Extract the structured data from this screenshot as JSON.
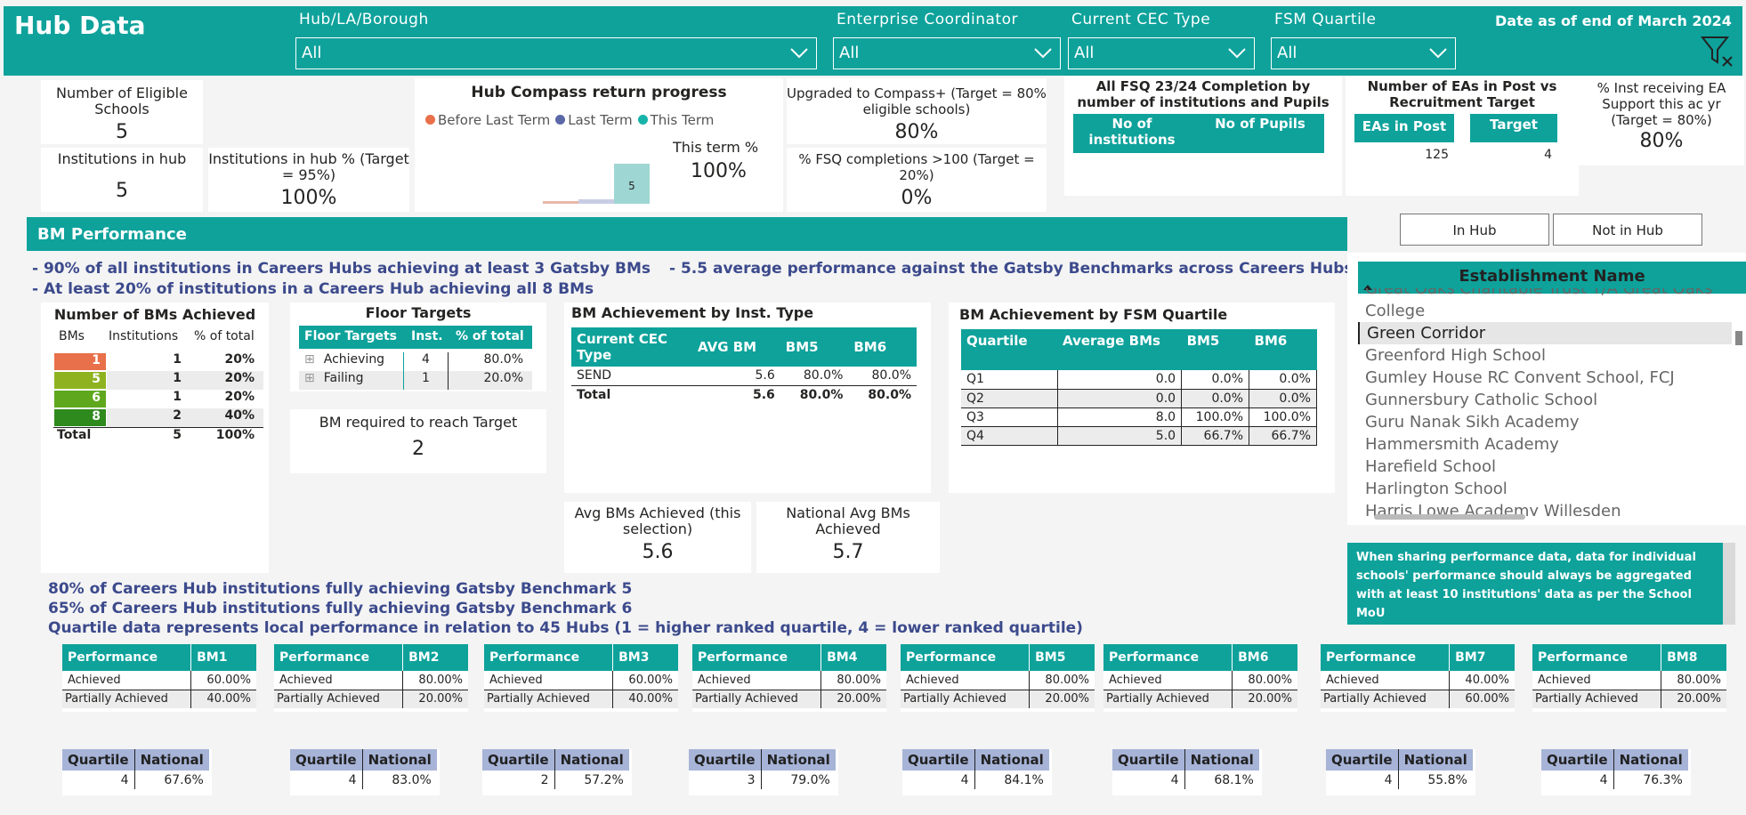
{
  "header": {
    "title": "Hub Data",
    "date_as_of": "Date as of end of March 2024",
    "filters": [
      {
        "label": "Hub/LA/Borough",
        "value": "All"
      },
      {
        "label": "Enterprise Coordinator",
        "value": "All"
      },
      {
        "label": "Current CEC Type",
        "value": "All"
      },
      {
        "label": "FSM Quartile",
        "value": "All"
      }
    ]
  },
  "kpis": {
    "eligible_label": "Number of Eligible Schools",
    "eligible_value": "5",
    "inst_label": "Institutions in hub",
    "inst_value": "5",
    "instpct_label": "Institutions in hub % (Target = 95%)",
    "instpct_value": "100%",
    "compass_title": "Hub Compass return progress",
    "compass_legend": [
      "Before Last Term",
      "Last Term",
      "This Term"
    ],
    "compass_legend_colors": [
      "#e8704a",
      "#5b68a8",
      "#16b3a9"
    ],
    "compass_thisterm_label": "This term %",
    "compass_thisterm_value": "100%",
    "compass_bar_label": "5",
    "upgraded_label": "Upgraded to Compass+ (Target = 80% eligible schools)",
    "upgraded_value": "80%",
    "fsq_label": "% FSQ completions >100 (Target = 20%)",
    "fsq_value": "0%",
    "fsq_title": "All FSQ 23/24 Completion by number of institutions and Pupils",
    "fsq_cols": [
      "No of institutions",
      "No of Pupils"
    ],
    "ea_title": "Number of EAs in Post vs Recruitment Target",
    "ea_cols": [
      "EAs in Post",
      "Target"
    ],
    "ea_values": [
      "125",
      "4"
    ],
    "inst_ea_label": "% Inst receiving EA Support this ac yr (Target = 80%)",
    "inst_ea_value": "80%"
  },
  "slicer": {
    "in_hub": "In Hub",
    "not_in_hub": "Not in Hub",
    "header": "Establishment Name",
    "items": [
      "Great Oaks Charitable Trust T/A Great Oaks",
      "College",
      "Green Corridor",
      "Greenford High School",
      "Gumley House RC Convent School, FCJ",
      "Gunnersbury Catholic School",
      "Guru Nanak Sikh Academy",
      "Hammersmith Academy",
      "Harefield School",
      "Harlington School",
      "Harris Lowe Academy Willesden"
    ],
    "selected": "Green Corridor"
  },
  "bm": {
    "section_title": "BM Performance",
    "line1": "- 90% of all institutions in Careers Hubs achieving at least 3 Gatsby BMs",
    "line1b": "- 5.5 average performance against the Gatsby Benchmarks across Careers Hubs",
    "line2": "- At least 20% of institutions in a Careers Hub achieving all 8 BMs",
    "achieved_title": "Number of BMs Achieved",
    "achieved_cols": [
      "BMs",
      "Institutions",
      "% of total"
    ],
    "achieved_rows": [
      {
        "bm": "1",
        "inst": "1",
        "pct": "20%",
        "color": "#e8704a"
      },
      {
        "bm": "5",
        "inst": "1",
        "pct": "20%",
        "color": "#8fb320"
      },
      {
        "bm": "6",
        "inst": "1",
        "pct": "20%",
        "color": "#5fa81e"
      },
      {
        "bm": "8",
        "inst": "2",
        "pct": "40%",
        "color": "#2e8a1c"
      }
    ],
    "achieved_total": {
      "label": "Total",
      "inst": "5",
      "pct": "100%"
    },
    "floor_title": "Floor Targets",
    "floor_cols": [
      "Floor Targets",
      "Inst.",
      "% of total"
    ],
    "floor_rows": [
      {
        "label": "Achieving",
        "inst": "4",
        "pct": "80.0%"
      },
      {
        "label": "Failing",
        "inst": "1",
        "pct": "20.0%"
      }
    ],
    "bm_req_label": "BM required to reach Target",
    "bm_req_value": "2",
    "insttype_title": "BM Achievement by Inst. Type",
    "insttype_cols": [
      "Current CEC Type",
      "AVG BM",
      "BM5",
      "BM6"
    ],
    "insttype_rows": [
      [
        "SEND",
        "5.6",
        "80.0%",
        "80.0%"
      ]
    ],
    "insttype_total": [
      "Total",
      "5.6",
      "80.0%",
      "80.0%"
    ],
    "fsm_title": "BM Achievement by FSM Quartile",
    "fsm_cols": [
      "Quartile",
      "Average BMs",
      "BM5",
      "BM6"
    ],
    "fsm_rows": [
      [
        "Q1",
        "0.0",
        "0.0%",
        "0.0%"
      ],
      [
        "Q2",
        "0.0",
        "0.0%",
        "0.0%"
      ],
      [
        "Q3",
        "8.0",
        "100.0%",
        "100.0%"
      ],
      [
        "Q4",
        "5.0",
        "66.7%",
        "66.7%"
      ]
    ],
    "avg_sel_label": "Avg BMs Achieved (this selection)",
    "avg_sel_value": "5.6",
    "nat_avg_label": "National Avg BMs Achieved",
    "nat_avg_value": "5.7",
    "note": "When sharing performance data, data for individual schools' performance should always be aggregated with at least 10 institutions' data as per the School MoU",
    "foot1": "80% of Careers Hub institutions fully achieving Gatsby Benchmark 5",
    "foot2": "65% of Careers Hub institutions fully achieving Gatsby Benchmark 6",
    "foot3": "Quartile data represents local performance in relation to 45 Hubs (1 = higher ranked quartile, 4 = lower ranked quartile)",
    "perf_tables": [
      {
        "bm": "BM1",
        "ach": "60.00%",
        "part": "40.00%",
        "q": "4",
        "nat": "67.6%"
      },
      {
        "bm": "BM2",
        "ach": "80.00%",
        "part": "20.00%",
        "q": "4",
        "nat": "83.0%"
      },
      {
        "bm": "BM3",
        "ach": "60.00%",
        "part": "40.00%",
        "q": "2",
        "nat": "57.2%"
      },
      {
        "bm": "BM4",
        "ach": "80.00%",
        "part": "20.00%",
        "q": "3",
        "nat": "79.0%"
      },
      {
        "bm": "BM5",
        "ach": "80.00%",
        "part": "20.00%",
        "q": "4",
        "nat": "84.1%"
      },
      {
        "bm": "BM6",
        "ach": "80.00%",
        "part": "20.00%",
        "q": "4",
        "nat": "68.1%"
      },
      {
        "bm": "BM7",
        "ach": "40.00%",
        "part": "60.00%",
        "q": "4",
        "nat": "55.8%"
      },
      {
        "bm": "BM8",
        "ach": "80.00%",
        "part": "20.00%",
        "q": "4",
        "nat": "76.3%"
      }
    ],
    "perf_labels": {
      "performance": "Performance",
      "achieved": "Achieved",
      "partial": "Partially Achieved",
      "quartile": "Quartile",
      "national": "National"
    }
  }
}
